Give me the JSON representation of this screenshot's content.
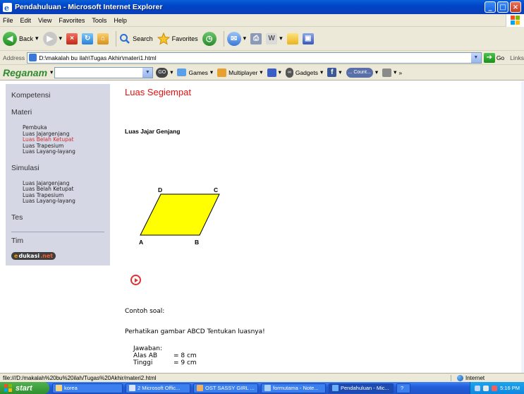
{
  "window": {
    "title": "Pendahuluan - Microsoft Internet Explorer",
    "colors": {
      "titlebar": "#0046c8",
      "accent_red": "#e01010",
      "sidebar_bg": "#d5d7e4",
      "shape_fill": "#ffff00"
    }
  },
  "menu": [
    "File",
    "Edit",
    "View",
    "Favorites",
    "Tools",
    "Help"
  ],
  "toolbar": {
    "back": "Back",
    "search": "Search",
    "favorites": "Favorites"
  },
  "address": {
    "label": "Address",
    "value": "D:\\makalah bu ilah\\Tugas Akhir\\materi1.html",
    "go": "Go",
    "links": "Links"
  },
  "reganam": {
    "brand": "Reganam",
    "go_pill": "GO",
    "games": "Games",
    "multiplayer": "Multiplayer",
    "gadgets": "Gadgets",
    "count": "... Count..."
  },
  "sidebar": {
    "kompetensi": "Kompetensi",
    "materi": "Materi",
    "materi_items": [
      "Pembuka",
      "Luas Jajargenjang",
      "Luas Belah Ketupat",
      "Luas Trapesium",
      "Luas Layang-layang"
    ],
    "materi_active_index": 2,
    "simulasi": "Simulasi",
    "simulasi_items": [
      "Luas Jajargenjang",
      "Luas Belah Ketupat",
      "Luas Trapesium",
      "Luas Layang-layang"
    ],
    "tes": "Tes",
    "tim": "Tim",
    "logo": {
      "e": "e",
      "dukasi": "dukasi",
      "net": ".net"
    }
  },
  "content": {
    "title": "Luas Segiempat",
    "subtitle": "Luas Jajar Genjang",
    "vertices": {
      "a": "A",
      "b": "B",
      "c": "C",
      "d": "D"
    },
    "contoh": "Contoh soal:",
    "perhatikan": "Perhatikan gambar ABCD Tentukan luasnya!",
    "jawaban_label": "Jawaban:",
    "alas_label": "Alas AB",
    "alas_value": "= 8 cm",
    "tinggi_label": "Tinggi",
    "tinggi_value": "= 9 cm"
  },
  "status": {
    "path": "file:///D:/makalah%20bu%20ilah/Tugas%20Akhir/materi2.html",
    "zone": "Internet"
  },
  "taskbar": {
    "start": "start",
    "tasks": [
      "korea",
      "2 Microsoft Offic...",
      "OST SASSY GIRL ...",
      "formutama - Note...",
      "Pendahuluan - Mic..."
    ],
    "active_index": 4,
    "tray_time": "5:16 PM"
  }
}
